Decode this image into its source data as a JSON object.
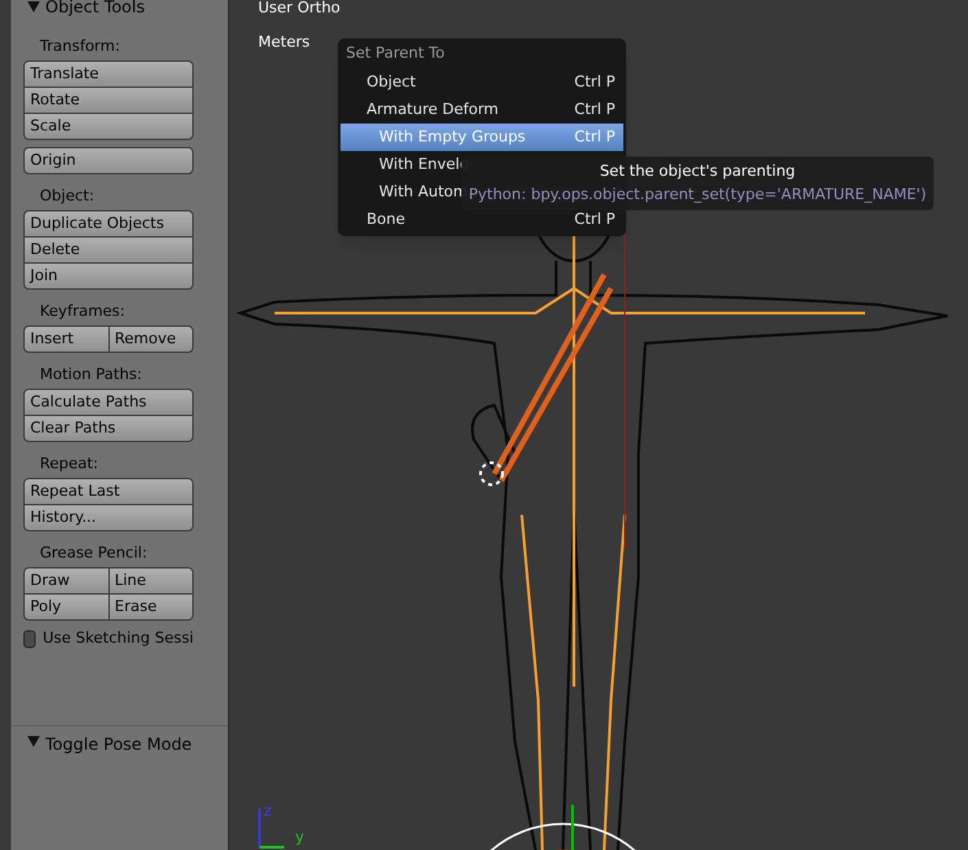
{
  "tool_panel": {
    "title": "Object Tools",
    "expanded": true,
    "sections": [
      {
        "label": "Transform:",
        "groups": [
          [
            "Translate",
            "Rotate",
            "Scale"
          ],
          [
            "Origin"
          ]
        ]
      },
      {
        "label": "Object:",
        "groups": [
          [
            "Duplicate Objects",
            "Delete",
            "Join"
          ]
        ]
      },
      {
        "label": "Keyframes:",
        "grid": [
          [
            "Insert",
            "Remove"
          ]
        ]
      },
      {
        "label": "Motion Paths:",
        "groups": [
          [
            "Calculate Paths",
            "Clear Paths"
          ]
        ]
      },
      {
        "label": "Repeat:",
        "groups": [
          [
            "Repeat Last",
            "History..."
          ]
        ]
      },
      {
        "label": "Grease Pencil:",
        "grid": [
          [
            "Draw",
            "Line"
          ],
          [
            "Poly",
            "Erase"
          ]
        ]
      }
    ],
    "checkbox": {
      "label": "Use Sketching Sessi",
      "checked": false
    },
    "footer": {
      "title": "Toggle Pose Mode",
      "expanded": true
    }
  },
  "viewport": {
    "view_name": "User Ortho",
    "units": "Meters",
    "axis_labels": [
      "z",
      "y"
    ]
  },
  "menu": {
    "title": "Set Parent To",
    "items": [
      {
        "label": "Object",
        "shortcut": "Ctrl P",
        "selected": false
      },
      {
        "label": "Armature Deform",
        "shortcut": "Ctrl P",
        "selected": false,
        "children": [
          {
            "label": "With Empty Groups",
            "shortcut": "Ctrl P",
            "selected": true
          },
          {
            "label": "With Envelo",
            "selected": false
          },
          {
            "label": "With Autom",
            "selected": false
          }
        ]
      },
      {
        "label": "Bone",
        "shortcut": "Ctrl P",
        "selected": false
      }
    ]
  },
  "tooltip": {
    "text": "Set the object's parenting",
    "python": "Python: bpy.ops.object.parent_set(type='ARMATURE_NAME')"
  }
}
